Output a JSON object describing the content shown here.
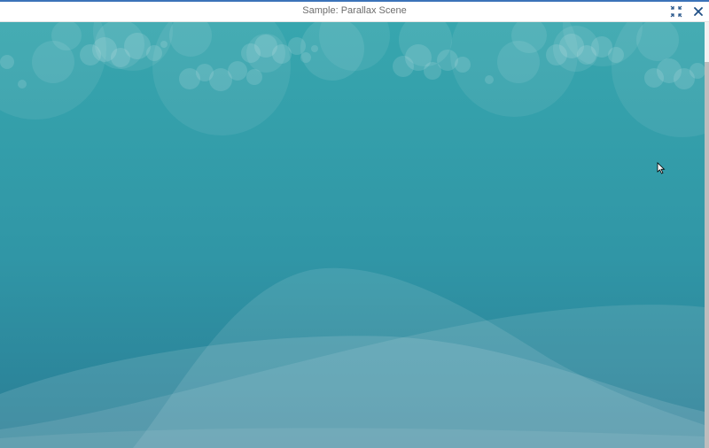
{
  "window": {
    "title": "Sample: Parallax Scene"
  },
  "icons": {
    "restore": "exit-fullscreen-icon",
    "close": "close-icon",
    "cursor": "mouse-pointer-icon"
  },
  "colors": {
    "accent": "#3b73b9",
    "scene_top": "#36a4ad",
    "scene_bottom": "#2b7f96",
    "bubble": "#ffffff",
    "icon": "#1f4f86"
  }
}
